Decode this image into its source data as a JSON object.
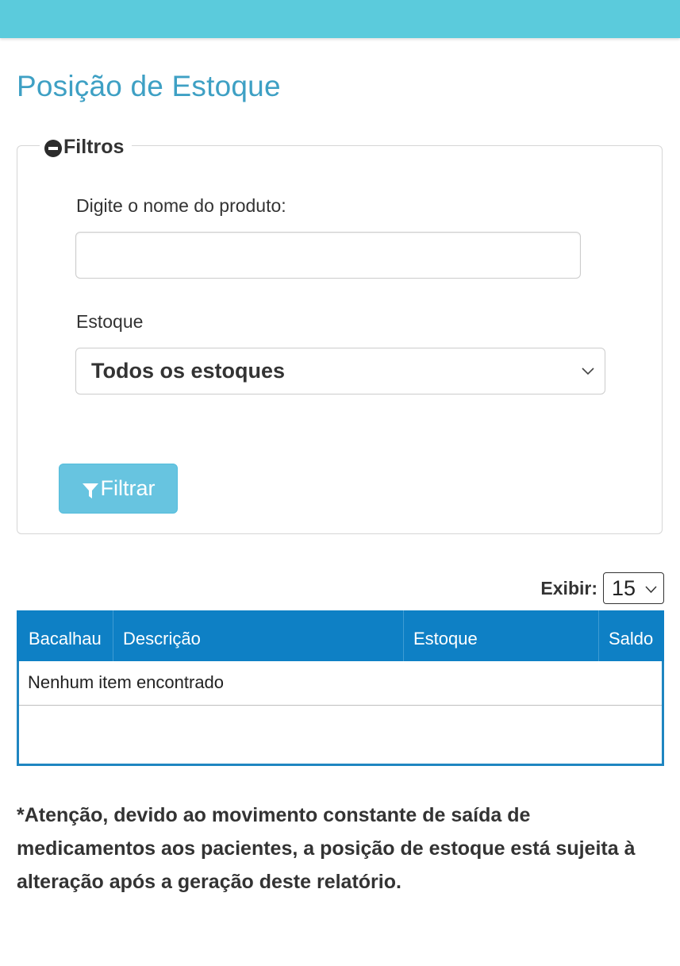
{
  "header": {
    "bar_color": "#5bcbdc"
  },
  "page": {
    "title": "Posição de Estoque"
  },
  "filters": {
    "legend": "Filtros",
    "legend_icon": "minus-circle-icon",
    "product_label": "Digite o nome do produto:",
    "product_value": "",
    "stock_label": "Estoque",
    "stock_selected": "Todos os estoques",
    "filter_button_label": "Filtrar",
    "filter_button_icon": "funnel-icon",
    "button_color": "#5bc0de"
  },
  "pagination": {
    "show_label": "Exibir:",
    "page_size": "15"
  },
  "table": {
    "header_color": "#0e80c5",
    "columns": [
      "Bacalhau",
      "Descrição",
      "Estoque",
      "Saldo"
    ],
    "empty_message": "Nenhum item encontrado"
  },
  "notice": {
    "text": "*Atenção, devido ao movimento constante de saída de medicamentos aos pacientes, a posição de estoque está sujeita à alteração após a geração deste relatório."
  }
}
